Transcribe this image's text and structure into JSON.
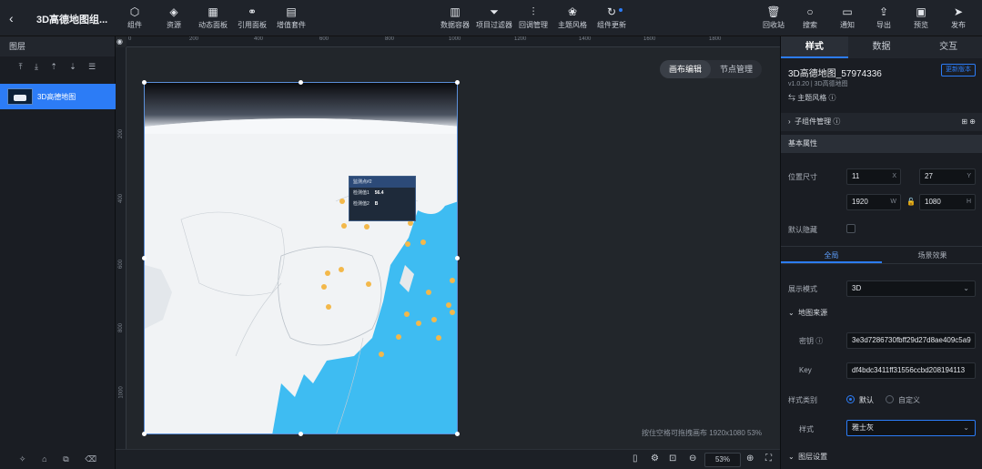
{
  "header": {
    "title": "3D高德地图组...",
    "left_tools": [
      {
        "label": "组件",
        "icon": "component-icon"
      },
      {
        "label": "资源",
        "icon": "resource-icon"
      },
      {
        "label": "动态面板",
        "icon": "dynamic-panel-icon"
      },
      {
        "label": "引用面板",
        "icon": "link-panel-icon"
      },
      {
        "label": "增值套件",
        "icon": "addon-kit-icon"
      }
    ],
    "center_tools": [
      {
        "label": "数据容器",
        "icon": "bar-chart-icon"
      },
      {
        "label": "项目过滤器",
        "icon": "filter-icon"
      },
      {
        "label": "回调管理",
        "icon": "sliders-icon"
      },
      {
        "label": "主题风格",
        "icon": "palette-icon"
      },
      {
        "label": "组件更新",
        "icon": "refresh-icon"
      }
    ],
    "right_tools": [
      {
        "label": "回收站",
        "icon": "trash-icon"
      },
      {
        "label": "搜索",
        "icon": "search-icon"
      },
      {
        "label": "通知",
        "icon": "message-icon"
      },
      {
        "label": "导出",
        "icon": "export-icon"
      },
      {
        "label": "预览",
        "icon": "preview-icon"
      },
      {
        "label": "发布",
        "icon": "send-icon"
      }
    ]
  },
  "layers": {
    "title": "图层",
    "items": [
      {
        "label": "3D高德地图"
      }
    ]
  },
  "canvas": {
    "ruler_h": [
      "0",
      "200",
      "400",
      "600",
      "800",
      "1000",
      "1200",
      "1400",
      "1600",
      "1800"
    ],
    "ruler_v": [
      "200",
      "400",
      "600",
      "800",
      "1000"
    ],
    "mode_edit": "画布编辑",
    "mode_node": "节点管理",
    "popup": {
      "title": "监测点#2",
      "row1_label": "检测值1",
      "row1_value": "56.4",
      "row2_label": "检测值2",
      "row2_value": "B"
    },
    "hint": "按住空格可拖拽画布 1920x1080 53%",
    "zoom": "53%"
  },
  "panel": {
    "tabs": [
      "样式",
      "数据",
      "交互"
    ],
    "comp_name": "3D高德地图_57974336",
    "update_btn": "更新版本",
    "version": "v1.0.20 | 3D高德地图",
    "theme": "主题风格",
    "sub_manage": "子组件管理",
    "basic": "基本属性",
    "pos_label": "位置尺寸",
    "x": "11",
    "y": "27",
    "w": "1920",
    "h": "1080",
    "x_suf": "X",
    "y_suf": "Y",
    "w_suf": "W",
    "h_suf": "H",
    "hide_label": "默认隐藏",
    "subtab_global": "全局",
    "subtab_scene": "场景效果",
    "mode_label": "展示模式",
    "mode_value": "3D",
    "source": "地图来源",
    "secret_label": "密钥",
    "secret_value": "3e3d7286730fbff29d27d8ae409c5a9",
    "key_label": "Key",
    "key_value": "df4bdc3411ff31556ccbd208194113",
    "type_label": "样式类别",
    "type_default": "默认",
    "type_custom": "自定义",
    "style_label": "样式",
    "style_value": "雅士灰",
    "layer_settings": "图层设置"
  }
}
